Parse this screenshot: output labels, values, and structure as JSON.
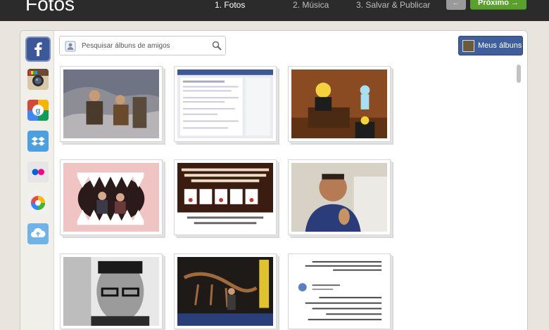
{
  "header": {
    "title": "Fotos",
    "steps": [
      {
        "label": "1. Fotos",
        "active": true
      },
      {
        "label": "2. Música",
        "active": false
      },
      {
        "label": "3. Salvar & Publicar",
        "active": false
      }
    ],
    "back_label": "←",
    "next_label": "Próximo →"
  },
  "sources": [
    {
      "name": "facebook",
      "selected": true
    },
    {
      "name": "instagram",
      "selected": false
    },
    {
      "name": "google-plus",
      "selected": false
    },
    {
      "name": "dropbox",
      "selected": false
    },
    {
      "name": "flickr",
      "selected": false
    },
    {
      "name": "picasa",
      "selected": false
    },
    {
      "name": "cloud-upload",
      "selected": false
    }
  ],
  "search": {
    "placeholder": "Pesquisar álbuns de amigos"
  },
  "albums_button": {
    "label": "Meus álbuns"
  },
  "photos": [
    {
      "subject": "cave people"
    },
    {
      "subject": "screenshot"
    },
    {
      "subject": "cartoon"
    },
    {
      "subject": "shark jaws"
    },
    {
      "subject": "poster arabic"
    },
    {
      "subject": "man smiling"
    },
    {
      "subject": "man glasses"
    },
    {
      "subject": "dinosaur"
    },
    {
      "subject": "arabic text"
    }
  ],
  "colors": {
    "accent_green": "#5aa02c",
    "facebook_blue": "#3b5998",
    "button_blue": "#3f5f9c"
  }
}
